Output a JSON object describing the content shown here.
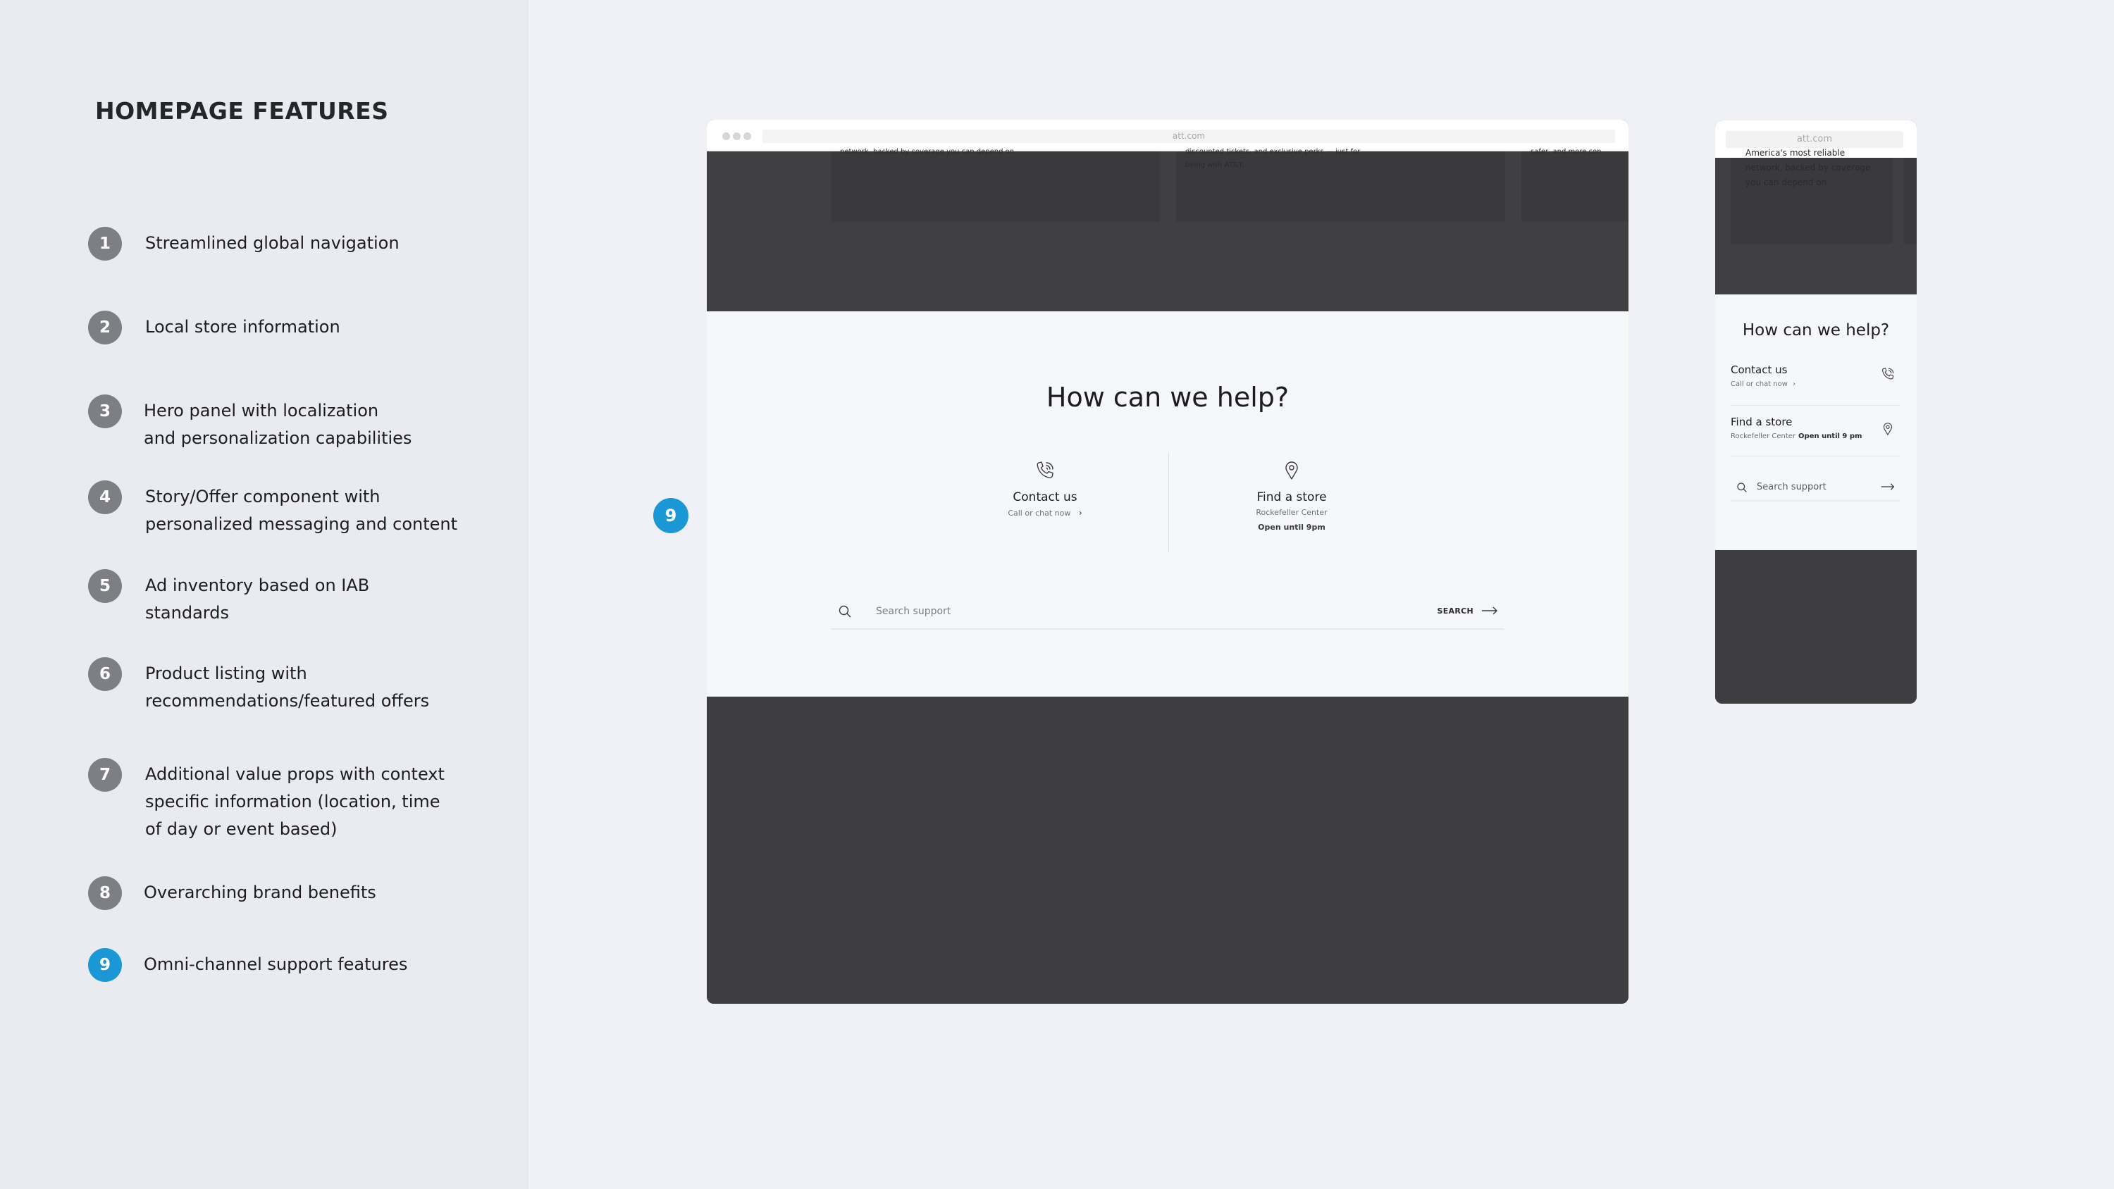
{
  "sidebar": {
    "title": "HOMEPAGE FEATURES",
    "features": [
      {
        "number": "1",
        "lines": [
          "Streamlined global navigation"
        ],
        "active": false
      },
      {
        "number": "2",
        "lines": [
          "Local store information"
        ],
        "active": false
      },
      {
        "number": "3",
        "lines": [
          "Hero panel with  localization",
          "and personalization capabilities"
        ],
        "active": false
      },
      {
        "number": "4",
        "lines": [
          "Story/Offer component with",
          "personalized messaging and content"
        ],
        "active": false
      },
      {
        "number": "5",
        "lines": [
          "Ad inventory based on IAB",
          "standards"
        ],
        "active": false
      },
      {
        "number": "6",
        "lines": [
          "Product listing with",
          "recommendations/featured offers"
        ],
        "active": false
      },
      {
        "number": "7",
        "lines": [
          "Additional value props with context",
          "specific information (location, time",
          "of day or event based)"
        ],
        "active": false
      },
      {
        "number": "8",
        "lines": [
          "Overarching brand benefits"
        ],
        "active": false
      },
      {
        "number": "9",
        "lines": [
          "Omni-channel support features"
        ],
        "active": true
      }
    ]
  },
  "callout": {
    "number": "9"
  },
  "colors": {
    "accent": "#1a98d5",
    "badge_inactive": "#7d7f84",
    "dark_panel": "#3e3e40"
  },
  "desktop": {
    "url": "att.com",
    "cards": [
      {
        "lines": [
          "network, backed by coverage you can depend on."
        ]
      },
      {
        "lines": [
          "discounted tickets, and exclusive perks — just for",
          "being with AT&T."
        ]
      },
      {
        "lines": [
          "safer, and more con"
        ]
      }
    ],
    "help": {
      "title": "How can we help?",
      "contact": {
        "icon": "phone-icon",
        "label": "Contact us",
        "sub": "Call or chat now"
      },
      "store": {
        "icon": "location-pin-icon",
        "label": "Find a store",
        "location": "Rockefeller Center",
        "hours": "Open until 9pm"
      },
      "search": {
        "placeholder": "Search support",
        "button": "SEARCH"
      }
    }
  },
  "mobile": {
    "url": "att.com",
    "card_lines": [
      "America's most reliable",
      "network, backed by coverage",
      "you can depend on."
    ],
    "help": {
      "title": "How can we help?",
      "contact": {
        "label": "Contact us",
        "sub": "Call or chat now"
      },
      "store": {
        "label": "Find a store",
        "location": "Rockefeller Center",
        "hours": "Open until 9 pm"
      },
      "search": {
        "placeholder": "Search support"
      }
    }
  }
}
